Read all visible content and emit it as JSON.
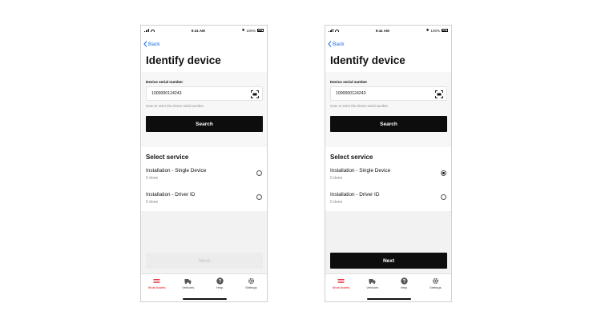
{
  "status_bar": {
    "time": "9:41 AM",
    "battery": "100%"
  },
  "nav": {
    "back_label": "Back"
  },
  "page": {
    "title": "Identify device"
  },
  "serial": {
    "label": "Device serial number",
    "value": "1000000124243",
    "helper": "Scan or enter the device serial number.",
    "search_label": "Search"
  },
  "service": {
    "title": "Select service",
    "options": [
      {
        "name": "Installation - Single Device",
        "status": "0 done"
      },
      {
        "name": "Installation - Driver ID",
        "status": "0 done"
      }
    ]
  },
  "next_label": "Next",
  "tabs": [
    "Work tickets",
    "Vehicles",
    "Help",
    "Settings"
  ],
  "colors": {
    "accent": "#e30613",
    "link": "#1a6fe0",
    "primary_button": "#0d0d0d"
  },
  "screens": [
    {
      "selected_service": null,
      "next_enabled": false
    },
    {
      "selected_service": 0,
      "next_enabled": true
    }
  ]
}
